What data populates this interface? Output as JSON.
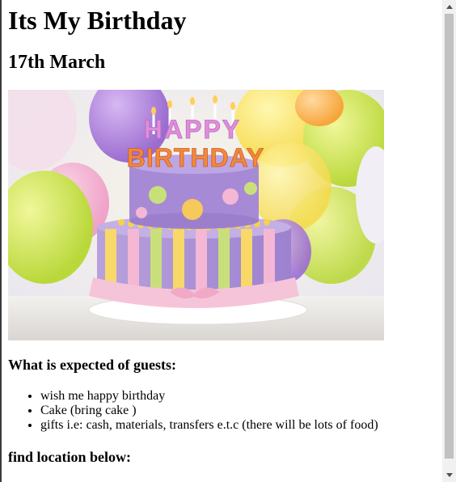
{
  "page": {
    "title": "Its My Birthday",
    "date": "17th March",
    "image_alt": "Birthday cake with Happy Birthday candles and balloons",
    "cake_text": {
      "happy": "HAPPY",
      "birthday": "BIRTHDAY"
    },
    "expectations_heading": "What is expected of guests:",
    "expectations": [
      "wish me happy birthday",
      "Cake (bring cake )",
      "gifts i.e: cash, materials, transfers e.t.c (there will be lots of food)"
    ],
    "location_heading": "find location below:"
  },
  "colors": {
    "background": "#ffffff",
    "text": "#000000",
    "scroll_track": "#f1f1f1",
    "scroll_thumb": "#c1c1c1"
  }
}
